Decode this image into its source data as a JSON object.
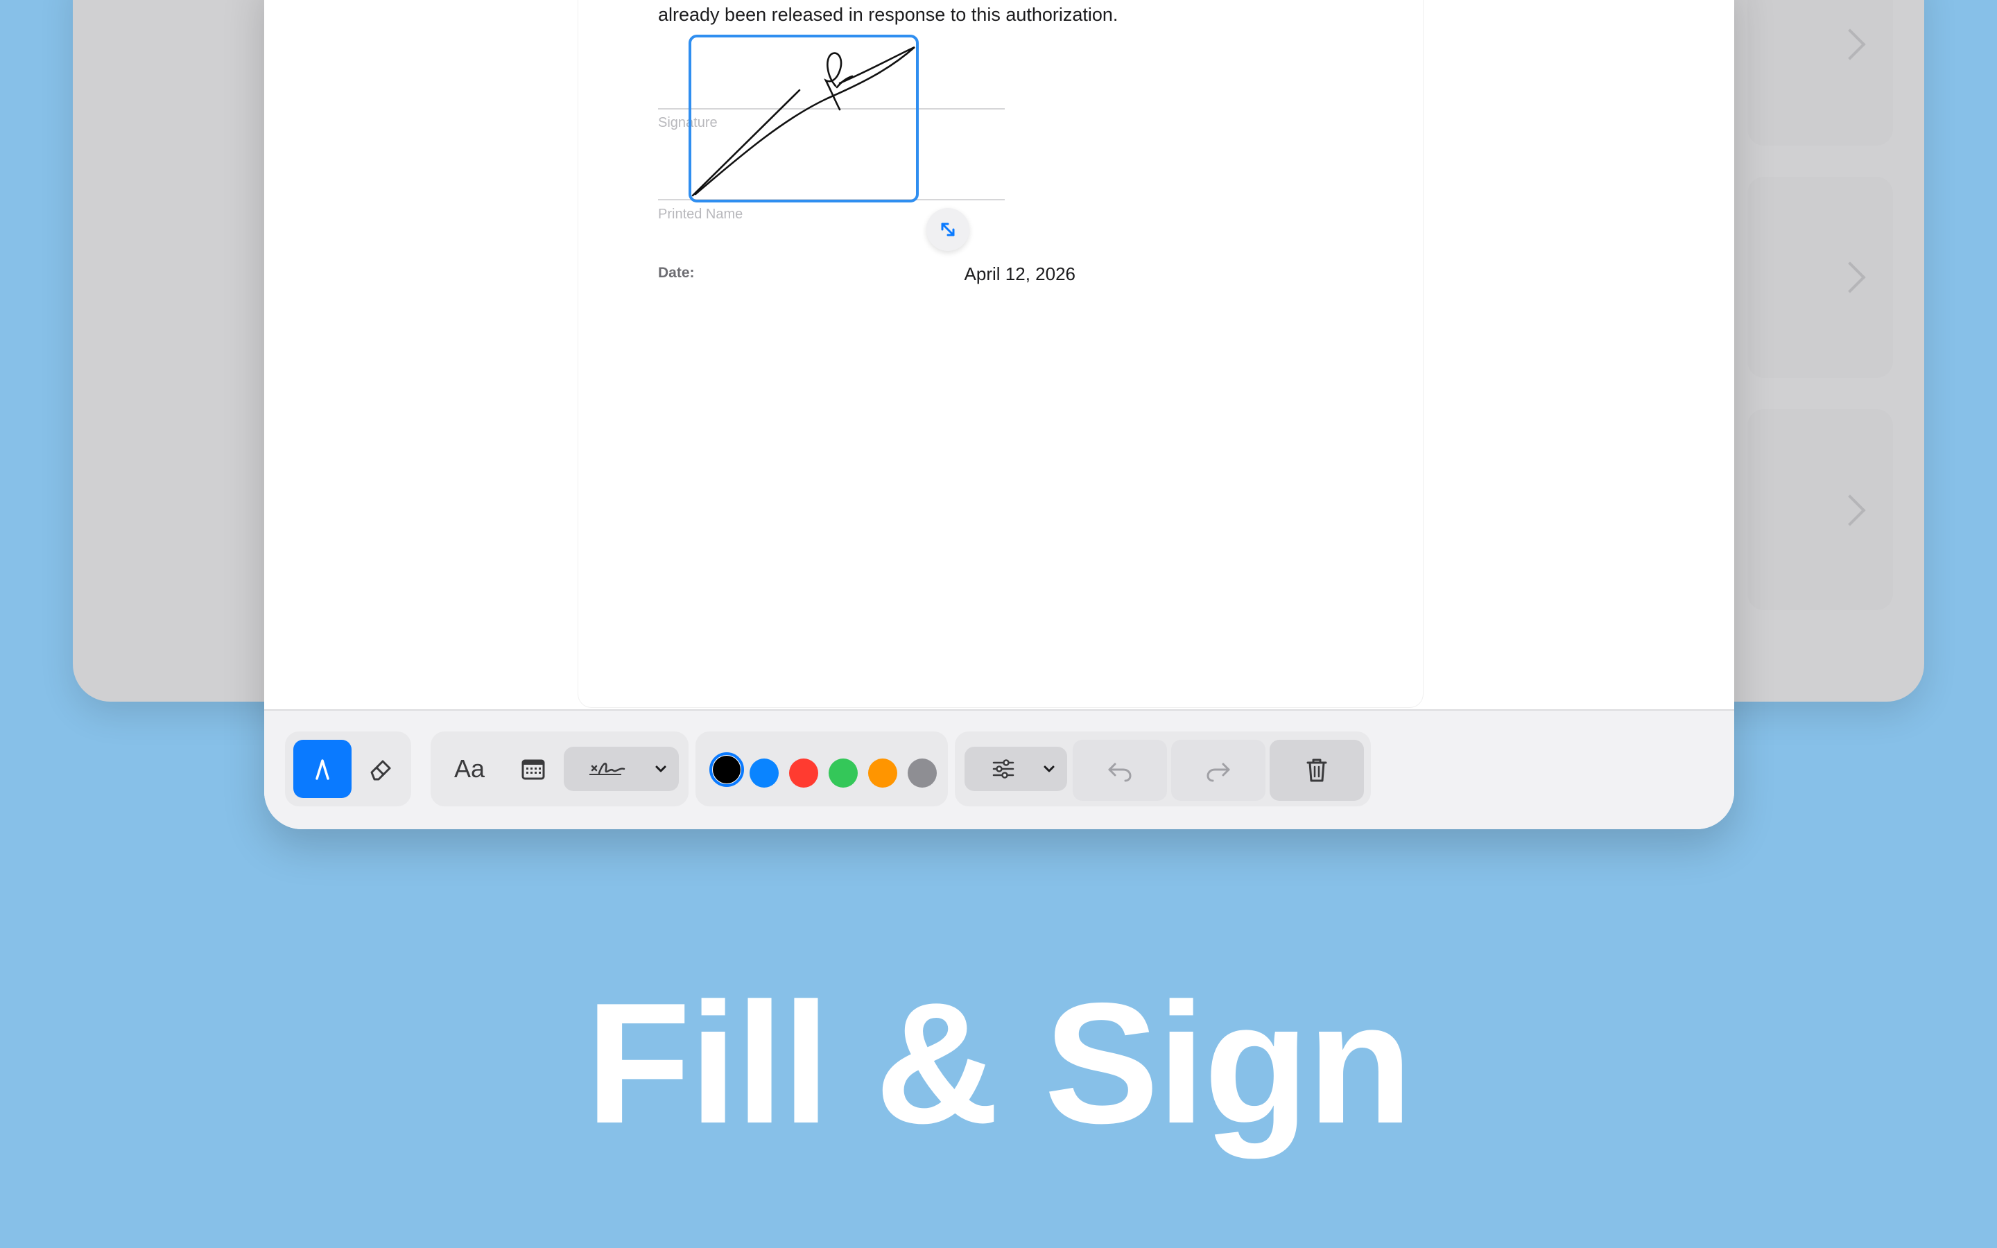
{
  "document": {
    "body_text": "already been released in response to this authorization.",
    "signature_label": "Signature",
    "printed_name_label": "Printed Name",
    "date_label": "Date:",
    "date_value": "April 12, 2026"
  },
  "toolbar": {
    "text_tool_label": "Aa",
    "colors": [
      "#000000",
      "#0a84ff",
      "#ff3b30",
      "#34c759",
      "#ff9500",
      "#8e8e93"
    ],
    "selected_color": "#000000",
    "accent": "#0a7aff"
  },
  "headline": "Fill & Sign"
}
